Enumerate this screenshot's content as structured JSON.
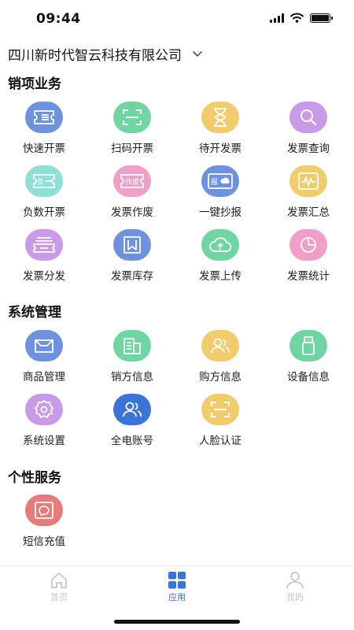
{
  "status_bar": {
    "time": "09:44"
  },
  "company": {
    "name": "四川新时代智云科技有限公司"
  },
  "sections": [
    {
      "title": "销项业务",
      "items": [
        {
          "label": "快速开票",
          "icon": "quick-invoice-icon",
          "color": "#6e92e0"
        },
        {
          "label": "扫码开票",
          "icon": "scan-code-icon",
          "color": "#6fd6a1"
        },
        {
          "label": "待开发票",
          "icon": "hourglass-icon",
          "color": "#f2cb6a"
        },
        {
          "label": "发票查询",
          "icon": "search-icon",
          "color": "#c99ae8"
        },
        {
          "label": "负数开票",
          "icon": "negative-invoice-icon",
          "color": "#8de0d6"
        },
        {
          "label": "发票作废",
          "icon": "void-invoice-icon",
          "color": "#ef9fc8"
        },
        {
          "label": "一键抄报",
          "icon": "report-upload-icon",
          "color": "#6e92e0"
        },
        {
          "label": "发票汇总",
          "icon": "summary-chart-icon",
          "color": "#f2cb6a"
        },
        {
          "label": "发票分发",
          "icon": "distribute-icon",
          "color": "#c99ae8"
        },
        {
          "label": "发票库存",
          "icon": "inventory-icon",
          "color": "#6e92e0"
        },
        {
          "label": "发票上传",
          "icon": "cloud-upload-icon",
          "color": "#6fd6a1"
        },
        {
          "label": "发票统计",
          "icon": "pie-chart-icon",
          "color": "#ef9fc8"
        }
      ]
    },
    {
      "title": "系统管理",
      "items": [
        {
          "label": "商品管理",
          "icon": "goods-box-icon",
          "color": "#6e92e0"
        },
        {
          "label": "销方信息",
          "icon": "building-icon",
          "color": "#6fd6a1"
        },
        {
          "label": "购方信息",
          "icon": "buyers-icon",
          "color": "#f2cb6a"
        },
        {
          "label": "设备信息",
          "icon": "usb-device-icon",
          "color": "#6fd6a1"
        },
        {
          "label": "系统设置",
          "icon": "gear-icon",
          "color": "#c99ae8"
        },
        {
          "label": "全电账号",
          "icon": "accounts-icon",
          "color": "#3b74d8"
        },
        {
          "label": "人脸认证",
          "icon": "face-scan-icon",
          "color": "#f2cb6a"
        }
      ]
    },
    {
      "title": "个性服务",
      "items": [
        {
          "label": "短信充值",
          "icon": "sms-icon",
          "color": "#e77a7a"
        }
      ]
    }
  ],
  "tabbar": [
    {
      "label": "首页",
      "icon": "home-icon",
      "active": false
    },
    {
      "label": "应用",
      "icon": "apps-grid-icon",
      "active": true
    },
    {
      "label": "我的",
      "icon": "profile-icon",
      "active": false
    }
  ],
  "colors": {
    "accent": "#3b74d8",
    "tab_inactive": "#c7c7c7"
  }
}
